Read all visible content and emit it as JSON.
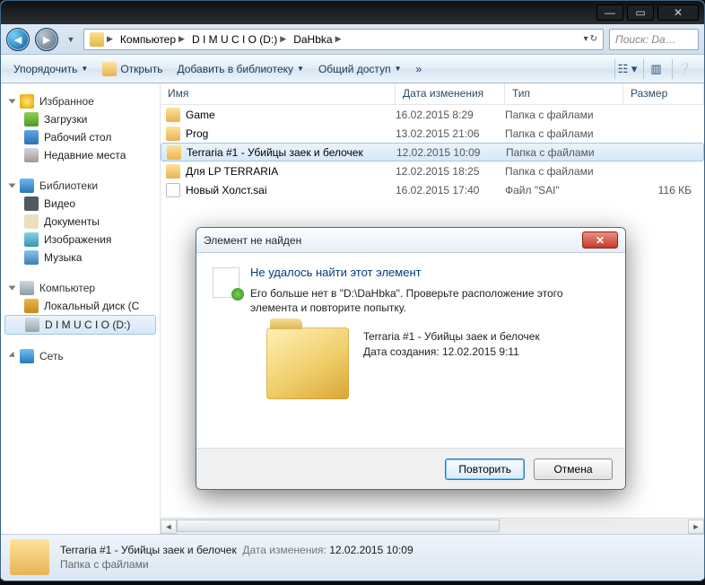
{
  "titlebar": {},
  "address": {
    "segments": [
      "Компьютер",
      "D I M U C I O (D:)",
      "DaHbka"
    ]
  },
  "search": {
    "placeholder": "Поиск: Da…"
  },
  "toolbar": {
    "organize": "Упорядочить",
    "open": "Открыть",
    "addToLibrary": "Добавить в библиотеку",
    "share": "Общий доступ",
    "burn": "»"
  },
  "columns": {
    "name": "Имя",
    "modified": "Дата изменения",
    "type": "Тип",
    "size": "Размер"
  },
  "sidebar": {
    "favorites": {
      "label": "Избранное",
      "items": [
        {
          "label": "Загрузки",
          "icon": "dl"
        },
        {
          "label": "Рабочий стол",
          "icon": "desk"
        },
        {
          "label": "Недавние места",
          "icon": "rec"
        }
      ]
    },
    "libraries": {
      "label": "Библиотеки",
      "items": [
        {
          "label": "Видео",
          "icon": "vid"
        },
        {
          "label": "Документы",
          "icon": "doc"
        },
        {
          "label": "Изображения",
          "icon": "img"
        },
        {
          "label": "Музыка",
          "icon": "mus"
        }
      ]
    },
    "computer": {
      "label": "Компьютер",
      "items": [
        {
          "label": "Локальный диск (C",
          "icon": "disk"
        },
        {
          "label": "D I M U C I O (D:)",
          "icon": "drv",
          "selected": true
        }
      ]
    },
    "network": {
      "label": "Сеть"
    }
  },
  "files": [
    {
      "name": "Game",
      "modified": "16.02.2015 8:29",
      "type": "Папка с файлами",
      "size": "",
      "icon": "fold"
    },
    {
      "name": "Prog",
      "modified": "13.02.2015 21:06",
      "type": "Папка с файлами",
      "size": "",
      "icon": "fold"
    },
    {
      "name": "Terraria #1 - Убийцы заек и белочек",
      "modified": "12.02.2015 10:09",
      "type": "Папка с файлами",
      "size": "",
      "icon": "fold",
      "selected": true
    },
    {
      "name": "Для LP TERRARIA",
      "modified": "12.02.2015 18:25",
      "type": "Папка с файлами",
      "size": "",
      "icon": "fold"
    },
    {
      "name": "Новый Холст.sai",
      "modified": "16.02.2015 17:40",
      "type": "Файл \"SAI\"",
      "size": "116 КБ",
      "icon": "file"
    }
  ],
  "details": {
    "name": "Terraria #1 - Убийцы заек и белочек",
    "modifiedLabel": "Дата изменения:",
    "modified": "12.02.2015 10:09",
    "type": "Папка с файлами"
  },
  "dialog": {
    "title": "Элемент не найден",
    "heading": "Не удалось найти этот элемент",
    "body": "Его больше нет в \"D:\\DaHbka\". Проверьте расположение этого элемента и повторите попытку.",
    "itemName": "Terraria #1 - Убийцы заек и белочек",
    "createdLabel": "Дата создания:",
    "created": "12.02.2015 9:11",
    "retry": "Повторить",
    "cancel": "Отмена"
  }
}
